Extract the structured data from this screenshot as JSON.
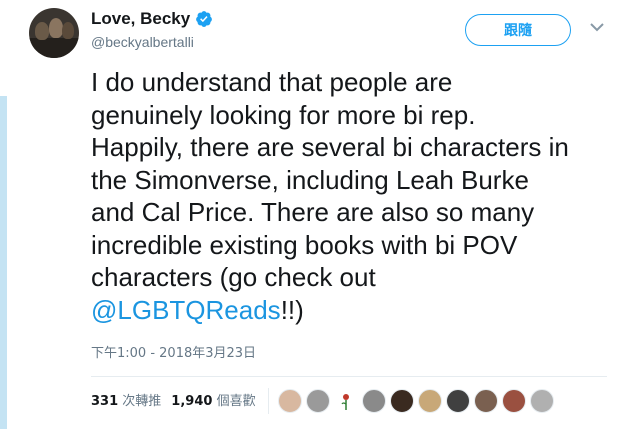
{
  "author": {
    "display_name": "Love, Becky",
    "handle": "@beckyalbertalli",
    "verified": true
  },
  "follow_button": {
    "label": "跟隨"
  },
  "tweet": {
    "text": "I do understand that people are\ngenuinely looking for more bi rep.\nHappily, there are several bi characters in\nthe Simonverse, including Leah Burke\nand Cal Price. There are also so many\nincredible existing books with bi POV\ncharacters (go check out\n",
    "mention": "@LGBTQReads",
    "tail": "!!)",
    "timestamp": "下午1:00 - 2018年3月23日"
  },
  "stats": {
    "retweets_count": "331",
    "retweets_label": "次轉推",
    "likes_count": "1,940",
    "likes_label": "個喜歡"
  },
  "likers": [
    {
      "color": "#d8b8a0"
    },
    {
      "color": "#9a9a9a"
    },
    {
      "color": "#ffffff"
    },
    {
      "color": "#8a8a8a"
    },
    {
      "color": "#3a2a20"
    },
    {
      "color": "#c8a878"
    },
    {
      "color": "#404040"
    },
    {
      "color": "#7a6050"
    },
    {
      "color": "#9a5040"
    },
    {
      "color": "#b0b0b0"
    }
  ],
  "colors": {
    "accent": "#1da1f2",
    "mention": "#1b95e0",
    "thread_line": "#c4e3f3"
  },
  "icons": {
    "verified": "verified-badge-icon",
    "caret": "chevron-down-icon",
    "rose": "rose-icon"
  }
}
